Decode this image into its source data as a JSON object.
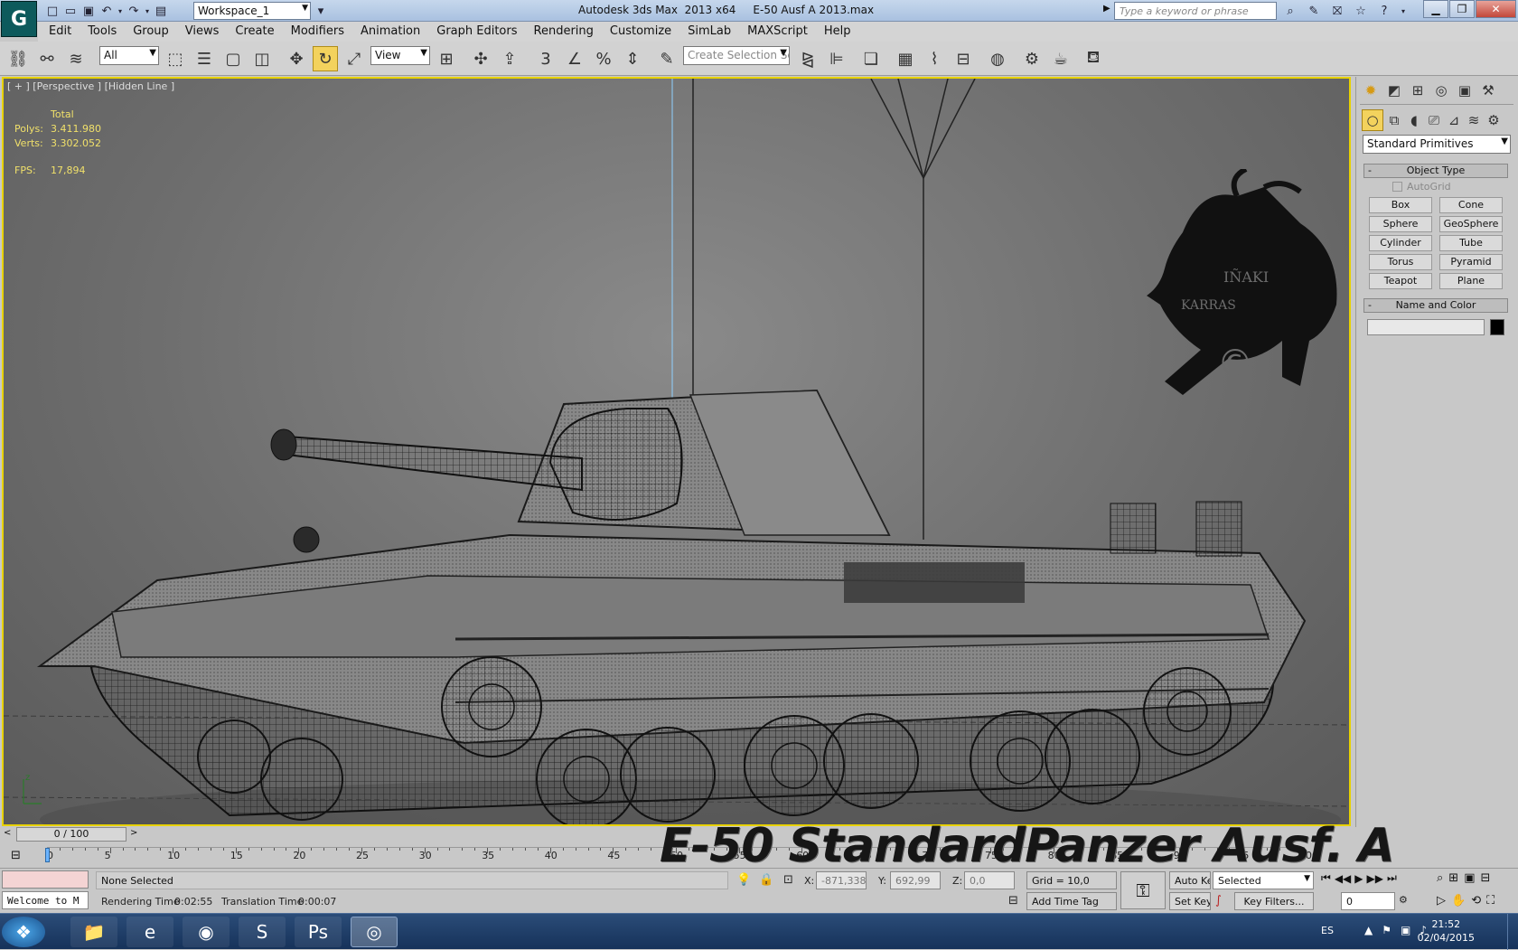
{
  "title": {
    "app_logo": "G",
    "workspace": "Workspace_1",
    "text": "Autodesk 3ds Max  2013 x64     E-50 Ausf A 2013.max",
    "search_placeholder": "Type a keyword or phrase"
  },
  "menu": [
    "Edit",
    "Tools",
    "Group",
    "Views",
    "Create",
    "Modifiers",
    "Animation",
    "Graph Editors",
    "Rendering",
    "Customize",
    "SimLab",
    "MAXScript",
    "Help"
  ],
  "toolbar": {
    "selection_filter": "All",
    "ref_coord": "View",
    "named_selection_placeholder": "Create Selection Se"
  },
  "viewport": {
    "label": "[ + ] [Perspective ] [Hidden Line ]",
    "stats_header": "Total",
    "polys_label": "Polys:",
    "polys_value": "3.411.980",
    "verts_label": "Verts:",
    "verts_value": "3.302.052",
    "fps_label": "FPS:",
    "fps_value": "17,894",
    "axis_z": "z",
    "watermark_line1": "IÑAKI",
    "watermark_line2": "KARRAS",
    "watermark_copy": "©"
  },
  "command_panel": {
    "category": "Standard Primitives",
    "object_type_title": "Object Type",
    "autogrid": "AutoGrid",
    "objects": [
      "Box",
      "Cone",
      "Sphere",
      "GeoSphere",
      "Cylinder",
      "Tube",
      "Torus",
      "Pyramid",
      "Teapot",
      "Plane"
    ],
    "name_color_title": "Name and Color"
  },
  "timeline": {
    "slider": "0 / 100",
    "ticks": [
      "0",
      "5",
      "10",
      "15",
      "20",
      "25",
      "30",
      "35",
      "40",
      "45",
      "50",
      "55",
      "60",
      "65",
      "70",
      "75",
      "80",
      "85",
      "90",
      "95",
      "100"
    ],
    "overlay_title": "E-50 StandardPanzer  Ausf. A"
  },
  "status": {
    "maxscript": "Welcome to M",
    "selection": "None Selected",
    "rendering_time_label": "Rendering Time",
    "rendering_time": "0:02:55",
    "translation_time_label": "Translation Time",
    "translation_time": "0:00:07",
    "x_label": "X:",
    "x_value": "-871,338",
    "y_label": "Y:",
    "y_value": "692,99",
    "z_label": "Z:",
    "z_value": "0,0",
    "grid": "Grid = 10,0",
    "add_time_tag": "Add Time Tag",
    "auto_key": "Auto Key",
    "set_key": "Set Key",
    "key_mode": "Selected",
    "key_filters": "Key Filters...",
    "frame": "0"
  },
  "taskbar": {
    "lang": "ES",
    "time": "21:52",
    "date": "02/04/2015"
  }
}
